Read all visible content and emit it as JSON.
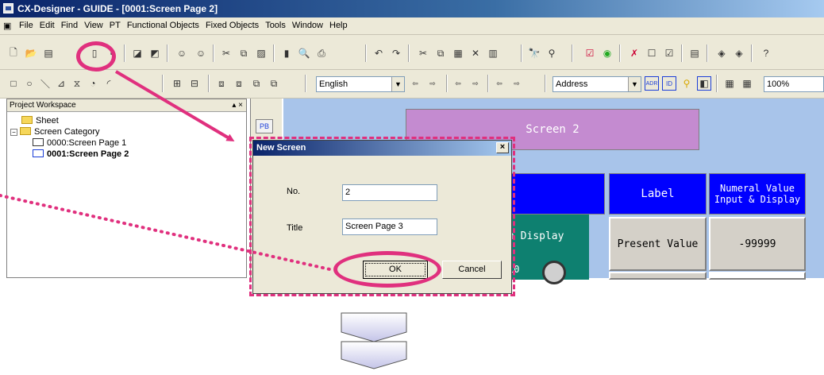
{
  "window": {
    "title": "CX-Designer - GUIDE - [0001:Screen Page 2]"
  },
  "menu": {
    "items": [
      "File",
      "Edit",
      "Find",
      "View",
      "PT",
      "Functional Objects",
      "Fixed Objects",
      "Tools",
      "Window",
      "Help"
    ]
  },
  "toolbar": {
    "language_value": "English",
    "address_value": "Address",
    "zoom_value": "100%",
    "addr_btn": "ADR",
    "id_btn": "ID"
  },
  "workspace": {
    "title": "Project Workspace",
    "controls": "▴ ×",
    "tree": {
      "sheet": "Sheet",
      "category": "Screen Category",
      "page1": "0000:Screen Page 1",
      "page2": "0001:Screen Page 2"
    }
  },
  "canvas": {
    "pb_label": "PB",
    "screen_title": "Screen 2",
    "label_header": "Label",
    "numeral_header": "Numeral Value Input & Display",
    "present_value": "Present Value",
    "value_display": "-99999",
    "teal_text": "n Display",
    "teal_sub": "10"
  },
  "dialog": {
    "title": "New Screen",
    "no_label": "No.",
    "no_value": "2",
    "title_label": "Title",
    "title_value": "Screen Page 3",
    "ok": "OK",
    "cancel": "Cancel",
    "close": "×"
  },
  "colors": {
    "annotation": "#e0307e",
    "canvas_bg": "#a8c4ea",
    "screen_title_bg": "#c48bd0",
    "header_blue": "#0000ff"
  }
}
